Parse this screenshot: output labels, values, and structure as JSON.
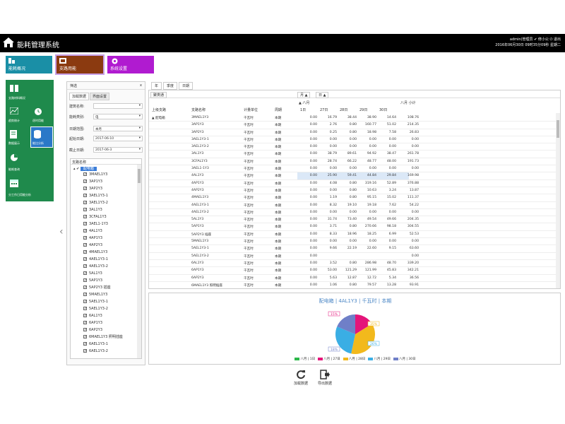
{
  "app": {
    "title": "能耗管理系统",
    "user_line": "admin(管理员 ✔ 修小公 ⏻ 退出",
    "datetime": "2016年06月30日 09时35分09秒 星期二"
  },
  "modules": [
    {
      "label": "能耗概况",
      "color": "#1a8fa6"
    },
    {
      "label": "支路用能",
      "color": "#8b3a10"
    },
    {
      "label": "系统设置",
      "color": "#b01bd0"
    }
  ],
  "sidebar": {
    "items": [
      "支路材料概况",
      "趋势统计",
      "逐时用能",
      "数据展示",
      "能比分析",
      "能耗查询",
      "分工作日用能分析"
    ]
  },
  "filter": {
    "title": "筛选",
    "close": "x",
    "tabs": [
      "加载数据",
      "界面设置"
    ],
    "fields": [
      {
        "label": "建筑名称:",
        "value": ""
      },
      {
        "label": "能耗类别:",
        "value": "电"
      },
      {
        "label": "日期范围:",
        "value": "本月"
      },
      {
        "label": "起始日期:",
        "value": "2017-06-10"
      },
      {
        "label": "截止日期:",
        "value": "2017-06-3"
      }
    ],
    "tree_header": "支路名称",
    "tree_root": "配电箱",
    "tree_items": [
      "3MAEL1Y3",
      "3AP1Y3",
      "3AP2Y3",
      "3AEL1Y3-1",
      "3AEL1Y3-2",
      "3AL1Y3",
      "3CFAL1Y3",
      "3AEL1-1Y3",
      "4AL1Y3",
      "4AP1Y3",
      "4AP2Y3",
      "4MAEL1Y3",
      "4AEL1Y3-1",
      "4AEL1Y3-2",
      "5AL1Y3",
      "5AP1Y3",
      "5AP2Y3 插座",
      "5MAEL1Y3",
      "5AEL1Y3-1",
      "5AEL1Y3-2",
      "6AL1Y3",
      "6AP1Y3",
      "6AP2Y3",
      "6MAEL1Y3 照明插座",
      "6AEL1Y3-1",
      "6AEL1Y3-2"
    ]
  },
  "top_tabs": [
    "年",
    "季度",
    "日期"
  ],
  "table": {
    "field_tag": "聚类通",
    "col_tags": [
      "月 ▲",
      "日 ▲"
    ],
    "month_label": "▲ 八月",
    "month_total": "八月 小计",
    "row_headers": [
      "上级支路",
      "支路名称",
      "计量单位",
      "周期"
    ],
    "day_headers": [
      "1日",
      "27日",
      "28日",
      "29日",
      "30日"
    ],
    "group": "▲ 配电箱",
    "unit": "千瓦时",
    "period": "本期",
    "rows": [
      [
        "3MAEL1Y3",
        "0.00",
        "16.79",
        "38.44",
        "38.90",
        "14.64",
        "108.76"
      ],
      [
        "3AP1Y3",
        "0.00",
        "2.76",
        "0.80",
        "160.77",
        "51.02",
        "214.35"
      ],
      [
        "3AP2Y3",
        "0.00",
        "0.25",
        "0.80",
        "18.98",
        "7.58",
        "26.83"
      ],
      [
        "3AEL1Y3-1",
        "0.00",
        "0.00",
        "0.00",
        "0.00",
        "0.00",
        "0.00"
      ],
      [
        "3AEL1Y3-2",
        "0.00",
        "0.00",
        "0.00",
        "0.00",
        "0.00",
        "0.00"
      ],
      [
        "3AL1Y3",
        "0.00",
        "38.79",
        "89.61",
        "94.92",
        "38.47",
        "261.78"
      ],
      [
        "3CFAL1Y3",
        "0.00",
        "28.74",
        "66.22",
        "48.77",
        "48.00",
        "191.73"
      ],
      [
        "3AEL1-1Y3",
        "0.00",
        "0.00",
        "0.00",
        "0.00",
        "0.00",
        "0.00"
      ],
      [
        "4AL1Y3",
        "0.00",
        "25.90",
        "59.41",
        "44.84",
        "29.84",
        "169.98"
      ],
      [
        "4AP1Y3",
        "0.00",
        "4.08",
        "0.80",
        "319.16",
        "52.89",
        "376.88"
      ],
      [
        "4AP2Y3",
        "0.00",
        "0.00",
        "0.80",
        "10.63",
        "3.24",
        "13.87"
      ],
      [
        "4MAEL1Y3",
        "0.00",
        "1.19",
        "0.80",
        "95.15",
        "15.02",
        "111.37"
      ],
      [
        "4AEL1Y3-1",
        "0.00",
        "8.32",
        "19.10",
        "19.18",
        "7.62",
        "54.22"
      ],
      [
        "4AEL1Y3-2",
        "0.00",
        "0.00",
        "0.00",
        "0.00",
        "0.00",
        "0.00"
      ],
      [
        "5AL1Y3",
        "0.00",
        "31.74",
        "73.40",
        "49.54",
        "49.66",
        "204.35"
      ],
      [
        "5AP1Y3",
        "0.00",
        "3.71",
        "0.80",
        "270.66",
        "98.18",
        "304.55"
      ],
      [
        "5AP2Y3 插座",
        "0.00",
        "8.33",
        "18.96",
        "18.25",
        "6.99",
        "52.53"
      ],
      [
        "5MAEL1Y3",
        "0.00",
        "0.00",
        "0.00",
        "0.00",
        "0.00",
        "0.00"
      ],
      [
        "5AEL1Y3-1",
        "0.00",
        "9.66",
        "22.19",
        "22.60",
        "9.15",
        "63.60"
      ],
      [
        "5AEL1Y3-2",
        "0.00",
        "",
        "",
        "",
        "",
        "0.00"
      ],
      [
        "6AL1Y3",
        "0.00",
        "3.52",
        "0.80",
        "286.98",
        "48.70",
        "339.20"
      ],
      [
        "6AP1Y3",
        "0.00",
        "53.00",
        "121.29",
        "121.99",
        "45.83",
        "342.21"
      ],
      [
        "6AP2Y3",
        "0.00",
        "5.63",
        "12.87",
        "12.72",
        "5.34",
        "36.56"
      ],
      [
        "6MAEL1Y3 照明插座",
        "0.00",
        "1.06",
        "0.80",
        "79.57",
        "13.28",
        "93.91"
      ],
      [
        "6AEL1Y3-1",
        "0.00",
        "4.50",
        "10.34",
        "7.05",
        "7.20",
        "29.89"
      ]
    ]
  },
  "chart_data": {
    "type": "pie",
    "title": "配电箱 | 4AL1Y3 | 千瓦时 | 本期",
    "categories": [
      "八月 | 1日",
      "八月 | 27日",
      "八月 | 28日",
      "八月 | 29日",
      "八月 | 30日"
    ],
    "values": [
      0.0,
      25.9,
      59.41,
      44.84,
      29.84
    ],
    "colors": [
      "#2db84a",
      "#e4157a",
      "#f2b91c",
      "#3aaee4",
      "#6f7fc8"
    ],
    "slice_labels": [
      "15%",
      "35%",
      "26%",
      "18%"
    ]
  },
  "buttons": {
    "reload": "加载数据",
    "export": "导出数据"
  }
}
